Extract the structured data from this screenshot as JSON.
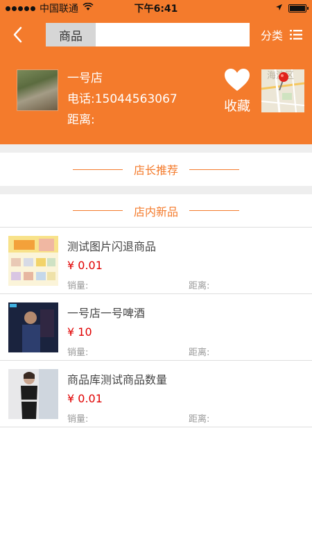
{
  "status_bar": {
    "carrier": "中国联通",
    "time": "下午6:41"
  },
  "navbar": {
    "search_category": "商品",
    "search_value": "",
    "category_label": "分类"
  },
  "store": {
    "name": "一号店",
    "phone": "电话:15044563067",
    "distance": "距离:",
    "favorite_label": "收藏",
    "map_text": "海淀区"
  },
  "sections": {
    "manager_recommend": "店长推荐",
    "new_products": "店内新品"
  },
  "products": [
    {
      "name": "测试图片闪退商品",
      "price": "¥ 0.01",
      "sales_label": "销量:",
      "distance_label": "距离:"
    },
    {
      "name": "一号店一号啤酒",
      "price": "¥ 10",
      "sales_label": "销量:",
      "distance_label": "距离:"
    },
    {
      "name": "商品库测试商品数量",
      "price": "¥ 0.01",
      "sales_label": "销量:",
      "distance_label": "距离:"
    }
  ],
  "colors": {
    "brand_orange": "#f47b2c",
    "price_red": "#e00000"
  }
}
